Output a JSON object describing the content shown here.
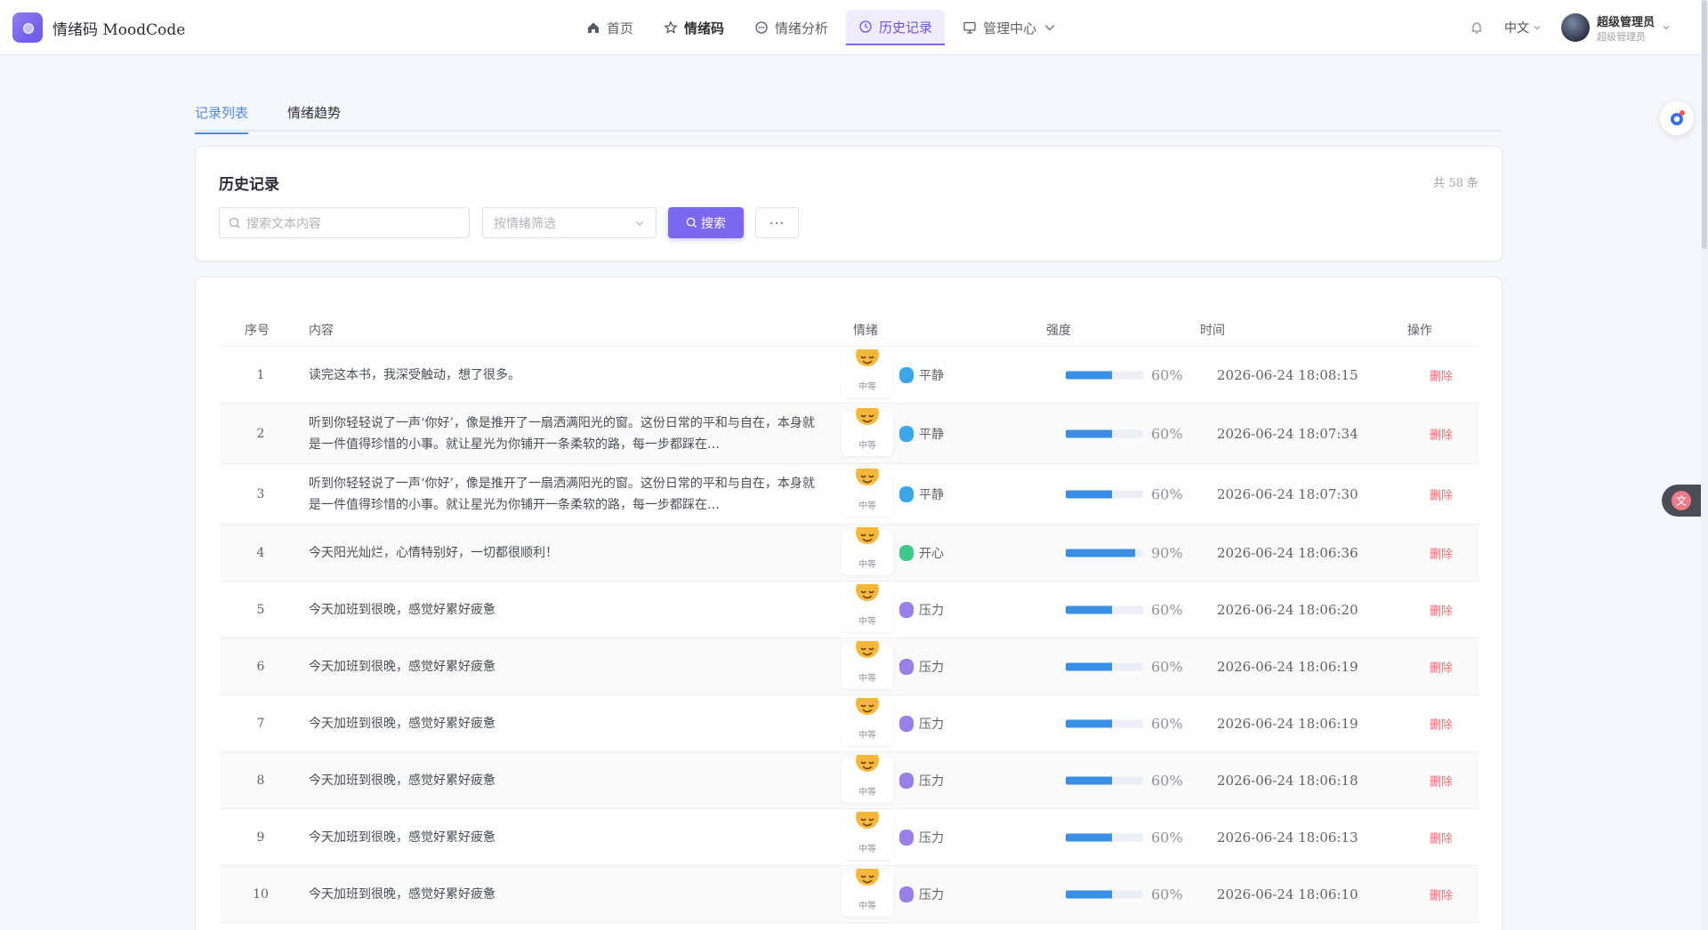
{
  "header": {
    "title": "情绪码 MoodCode",
    "nav": [
      {
        "label": "首页",
        "icon": "home-icon"
      },
      {
        "label": "情绪码",
        "icon": "star-icon"
      },
      {
        "label": "情绪分析",
        "icon": "chat-icon"
      },
      {
        "label": "历史记录",
        "icon": "clock-icon"
      },
      {
        "label": "管理中心",
        "icon": "monitor-icon"
      }
    ],
    "language": "中文",
    "user": {
      "name": "超级管理员",
      "role": "超级管理员"
    }
  },
  "tabs": [
    "记录列表",
    "情绪趋势"
  ],
  "search_card": {
    "title": "历史记录",
    "count": "共 58 条",
    "search_placeholder": "搜索文本内容",
    "filter_placeholder": "按情绪筛选",
    "search_button": "搜索",
    "more_button": "···"
  },
  "table": {
    "columns": [
      "序号",
      "内容",
      "情绪",
      "强度",
      "时间",
      "操作"
    ],
    "level_label": "中等",
    "delete_label": "删除",
    "rows": [
      {
        "idx": "1",
        "text": "读完这本书，我深受触动，想了很多。",
        "emotion": "平静",
        "emotion_color": "#3aa8e8",
        "intensity": 60,
        "intensity_label": "60%",
        "time": "2026-06-24 18:08:15"
      },
      {
        "idx": "2",
        "text": "听到你轻轻说了一声‘你好’，像是推开了一扇洒满阳光的窗。这份日常的平和与自在，本身就是一件值得珍惜的小事。就让星光为你铺开一条柔软的路，每一步都踩在…",
        "emotion": "平静",
        "emotion_color": "#3aa8e8",
        "intensity": 60,
        "intensity_label": "60%",
        "time": "2026-06-24 18:07:34"
      },
      {
        "idx": "3",
        "text": "听到你轻轻说了一声‘你好’，像是推开了一扇洒满阳光的窗。这份日常的平和与自在，本身就是一件值得珍惜的小事。就让星光为你铺开一条柔软的路，每一步都踩在…",
        "emotion": "平静",
        "emotion_color": "#3aa8e8",
        "intensity": 60,
        "intensity_label": "60%",
        "time": "2026-06-24 18:07:30"
      },
      {
        "idx": "4",
        "text": "今天阳光灿烂，心情特别好，一切都很顺利！",
        "emotion": "开心",
        "emotion_color": "#3fc98a",
        "intensity": 90,
        "intensity_label": "90%",
        "time": "2026-06-24 18:06:36"
      },
      {
        "idx": "5",
        "text": "今天加班到很晚，感觉好累好疲惫",
        "emotion": "压力",
        "emotion_color": "#9a80e6",
        "intensity": 60,
        "intensity_label": "60%",
        "time": "2026-06-24 18:06:20"
      },
      {
        "idx": "6",
        "text": "今天加班到很晚，感觉好累好疲惫",
        "emotion": "压力",
        "emotion_color": "#9a80e6",
        "intensity": 60,
        "intensity_label": "60%",
        "time": "2026-06-24 18:06:19"
      },
      {
        "idx": "7",
        "text": "今天加班到很晚，感觉好累好疲惫",
        "emotion": "压力",
        "emotion_color": "#9a80e6",
        "intensity": 60,
        "intensity_label": "60%",
        "time": "2026-06-24 18:06:19"
      },
      {
        "idx": "8",
        "text": "今天加班到很晚，感觉好累好疲惫",
        "emotion": "压力",
        "emotion_color": "#9a80e6",
        "intensity": 60,
        "intensity_label": "60%",
        "time": "2026-06-24 18:06:18"
      },
      {
        "idx": "9",
        "text": "今天加班到很晚，感觉好累好疲惫",
        "emotion": "压力",
        "emotion_color": "#9a80e6",
        "intensity": 60,
        "intensity_label": "60%",
        "time": "2026-06-24 18:06:13"
      },
      {
        "idx": "10",
        "text": "今天加班到很晚，感觉好累好疲惫",
        "emotion": "压力",
        "emotion_color": "#9a80e6",
        "intensity": 60,
        "intensity_label": "60%",
        "time": "2026-06-24 18:06:10"
      }
    ]
  },
  "colors": {
    "accent": "#7c68ee",
    "tab_active": "#4f8be8",
    "bar": "#3b8ee6",
    "danger": "#f56c6c"
  }
}
